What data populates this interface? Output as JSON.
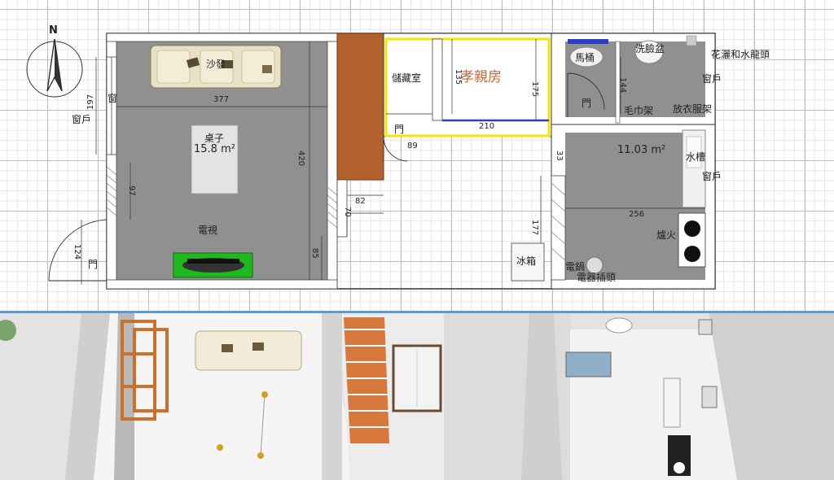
{
  "plan": {
    "compass": {
      "north_label": "N"
    },
    "rooms": {
      "living": {
        "area": "15.8 m²",
        "sofa": "沙發",
        "table": "桌子",
        "tv": "電視",
        "window": "窗戶",
        "door": "門",
        "window_small": "窗"
      },
      "storage": {
        "label": "儲藏室",
        "door": "門"
      },
      "parents_room": {
        "label": "孝親房"
      },
      "bathroom": {
        "toilet": "馬桶",
        "basin": "洗臉盆",
        "door": "門",
        "towel": "毛巾架",
        "clothes": "放衣服架",
        "window": "窗戶",
        "shower": "花灑和水龍頭"
      },
      "kitchen": {
        "area": "11.03 m²",
        "sink": "水槽",
        "window": "窗戶",
        "stove": "爐火",
        "fridge": "冰箱",
        "rice_cooker": "電鍋",
        "socket": "電器插頭"
      }
    },
    "dimensions": {
      "d197": "197",
      "d377": "377",
      "d420": "420",
      "d97": "97",
      "d124": "124",
      "d85": "85",
      "d82": "82",
      "d70": "70",
      "d89": "89",
      "d135": "135",
      "d175": "175",
      "d210": "210",
      "d144": "144",
      "d33": "33",
      "d177": "177",
      "d256": "256"
    }
  },
  "colors": {
    "floor": "#909090",
    "wall": "#ffffff",
    "stair": "#b3622e",
    "highlight": "#f5e600",
    "accent_line": "#2a40c8",
    "tv_stand": "#1fb81f",
    "divider": "#5b9bd5"
  }
}
